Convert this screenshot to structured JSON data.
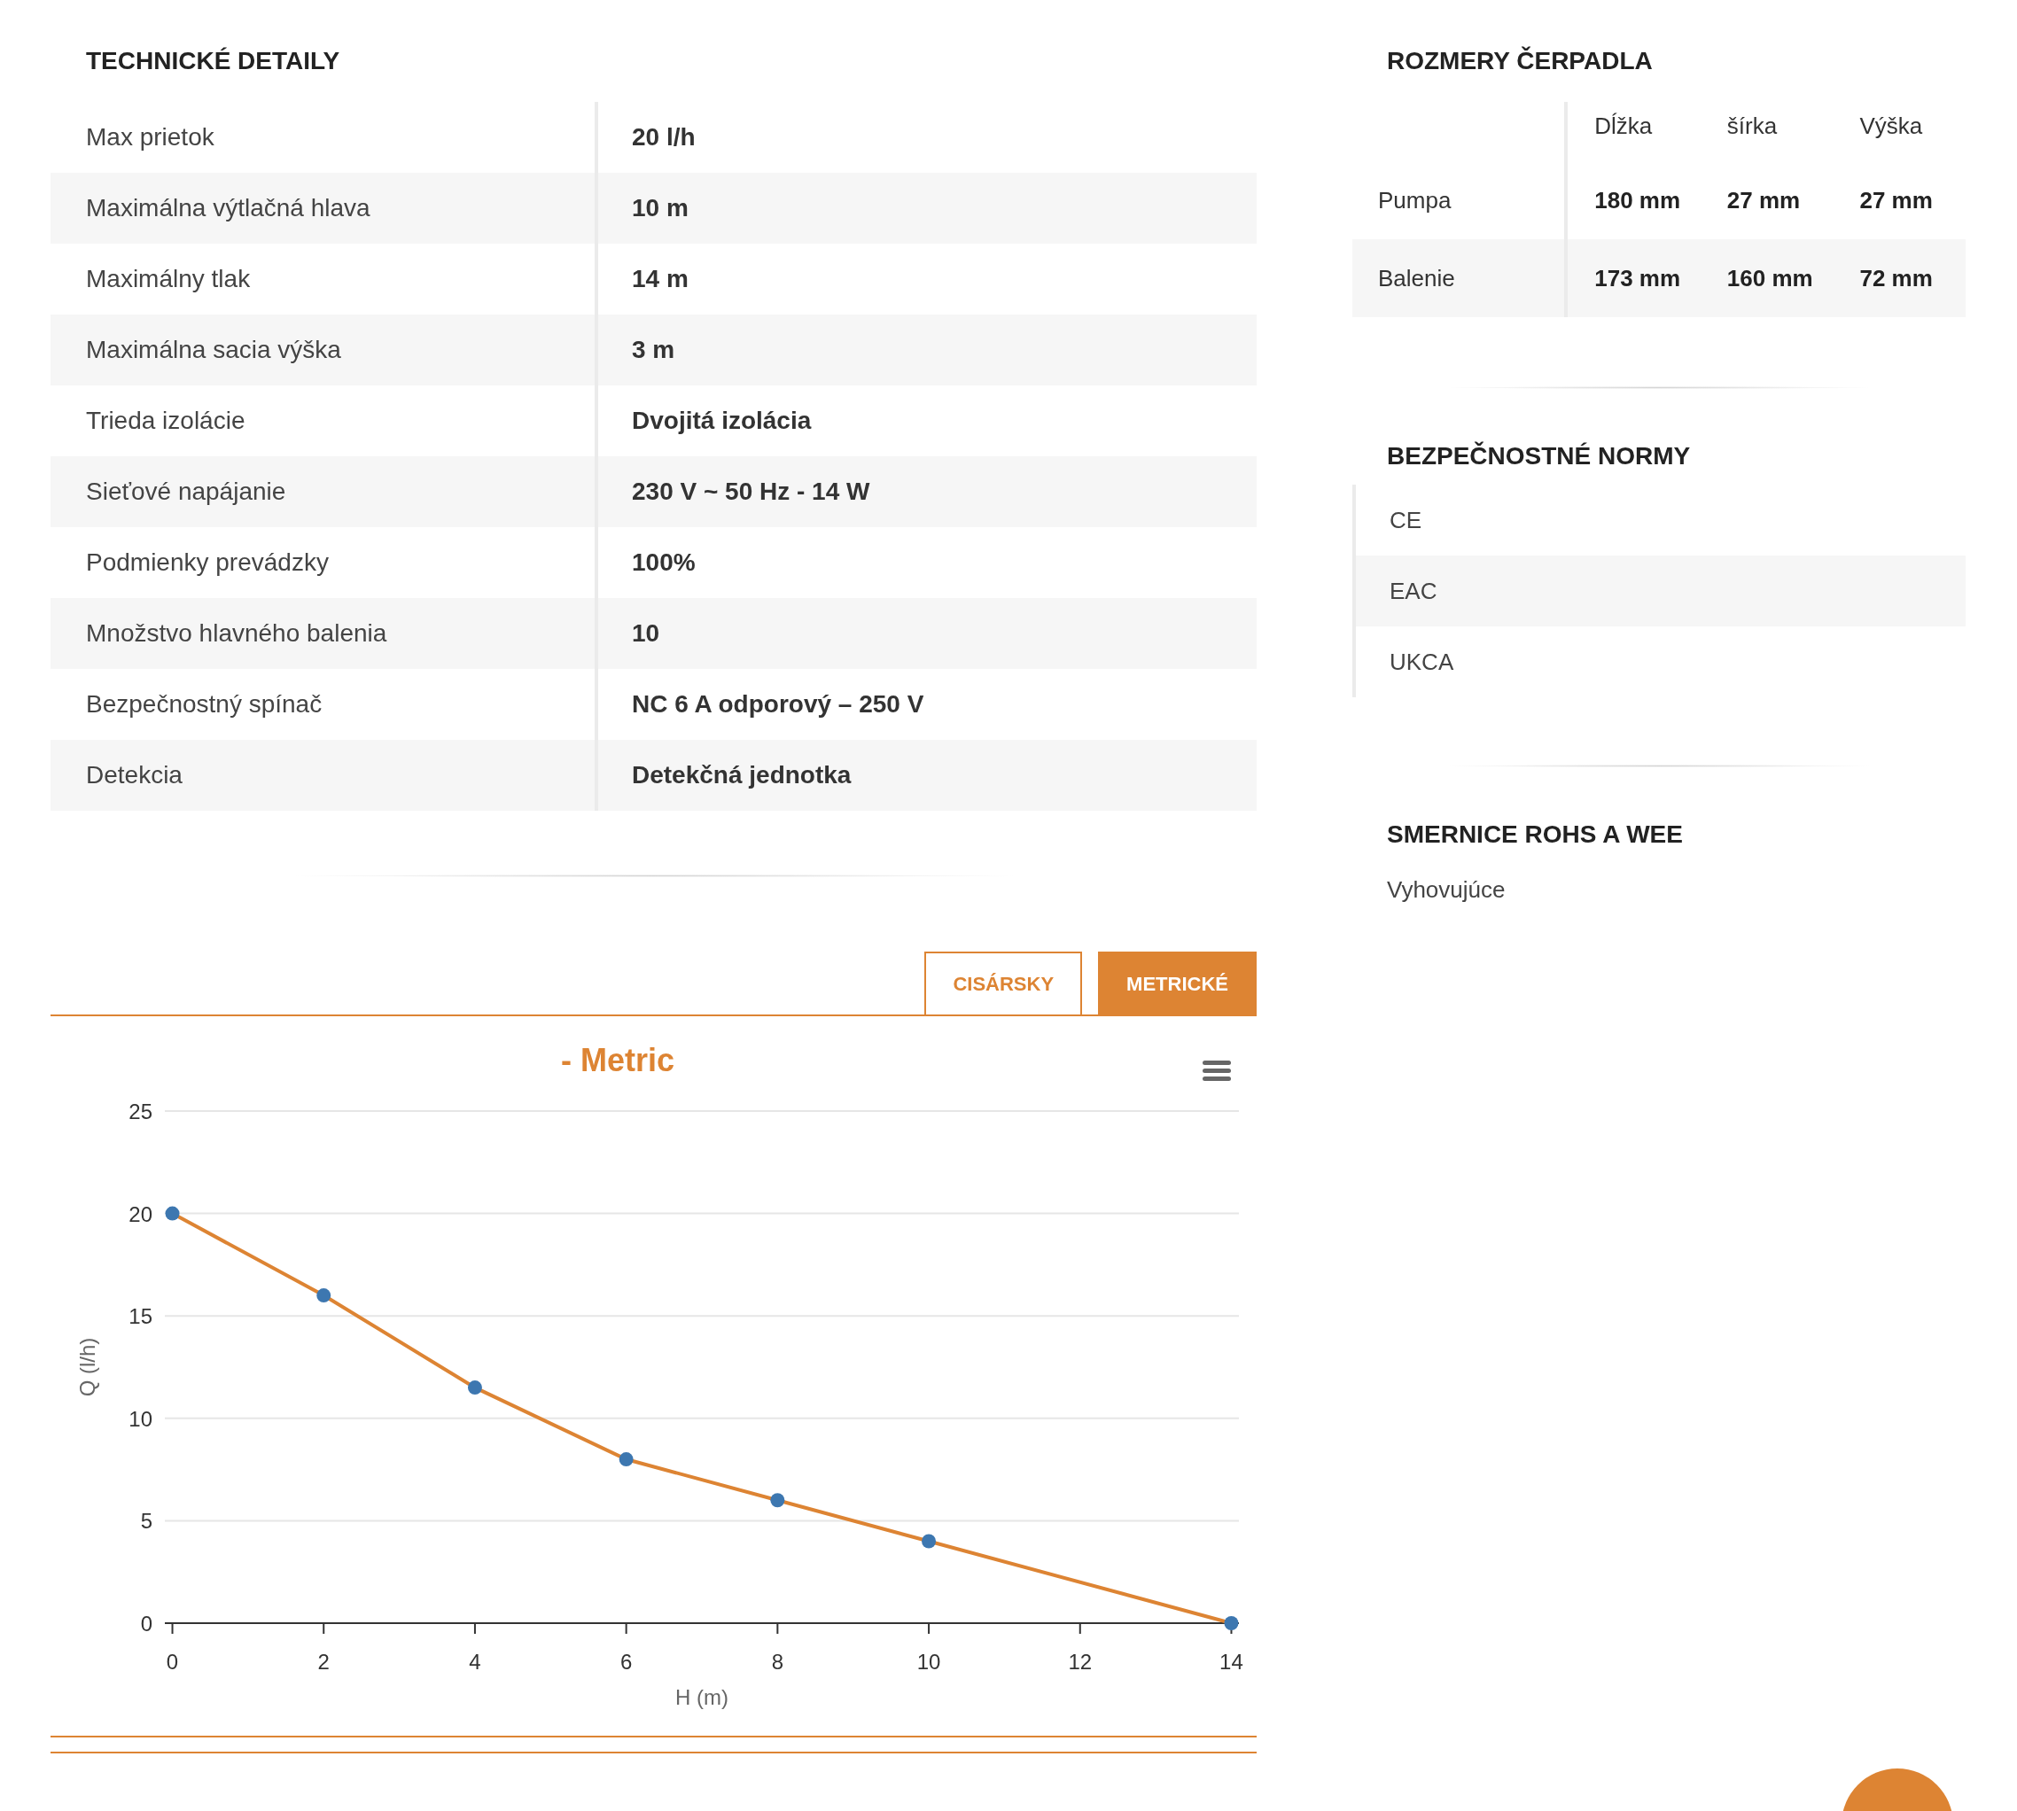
{
  "technical_details": {
    "title": "TECHNICKÉ DETAILY",
    "rows": [
      {
        "label": "Max prietok",
        "value": "20 l/h"
      },
      {
        "label": "Maximálna výtlačná hlava",
        "value": "10 m"
      },
      {
        "label": "Maximálny tlak",
        "value": "14 m"
      },
      {
        "label": "Maximálna sacia výška",
        "value": "3 m"
      },
      {
        "label": "Trieda izolácie",
        "value": "Dvojitá izolácia"
      },
      {
        "label": "Sieťové napájanie",
        "value": "230 V ~ 50 Hz - 14 W"
      },
      {
        "label": "Podmienky prevádzky",
        "value": "100%"
      },
      {
        "label": "Množstvo hlavného balenia",
        "value": "10"
      },
      {
        "label": "Bezpečnostný spínač",
        "value": "NC 6 A odporový – 250 V"
      },
      {
        "label": "Detekcia",
        "value": "Detekčná jednotka"
      }
    ]
  },
  "unit_tabs": [
    {
      "label": "CISÁRSKY",
      "selected": false
    },
    {
      "label": "METRICKÉ",
      "selected": true
    }
  ],
  "chart": {
    "title": "- Metric",
    "chart_data": {
      "type": "line",
      "xlabel": "H (m)",
      "ylabel": "Q (l/h)",
      "x": [
        0,
        2,
        4,
        6,
        8,
        10,
        14
      ],
      "series": [
        {
          "color": "#dd8433",
          "marker": "circle",
          "values": [
            20,
            16,
            11.5,
            8,
            6,
            4,
            0
          ]
        }
      ],
      "grid": true,
      "xlim": [
        -0.1,
        14.1
      ],
      "ylim": [
        0,
        25
      ],
      "xticks": [
        0,
        2,
        4,
        6,
        8,
        10,
        12,
        14
      ],
      "yticks": [
        0,
        5,
        10,
        15,
        20,
        25
      ]
    }
  },
  "pump_dimensions": {
    "title": "ROZMERY ČERPADLA",
    "columns": [
      "Dĺžka",
      "šírka",
      "Výška"
    ],
    "rows": [
      {
        "label": "Pumpa",
        "cells": [
          "180 mm",
          "27 mm",
          "27 mm"
        ]
      },
      {
        "label": "Balenie",
        "cells": [
          "173 mm",
          "160 mm",
          "72 mm"
        ]
      }
    ]
  },
  "safety_standards": {
    "title": "BEZPEČNOSTNÉ NORMY",
    "items": [
      "CE",
      "EAC",
      "UKCA"
    ]
  },
  "rohs_weee": {
    "title": "SMERNICE ROHS A WEE",
    "text": "Vyhovujúce"
  }
}
